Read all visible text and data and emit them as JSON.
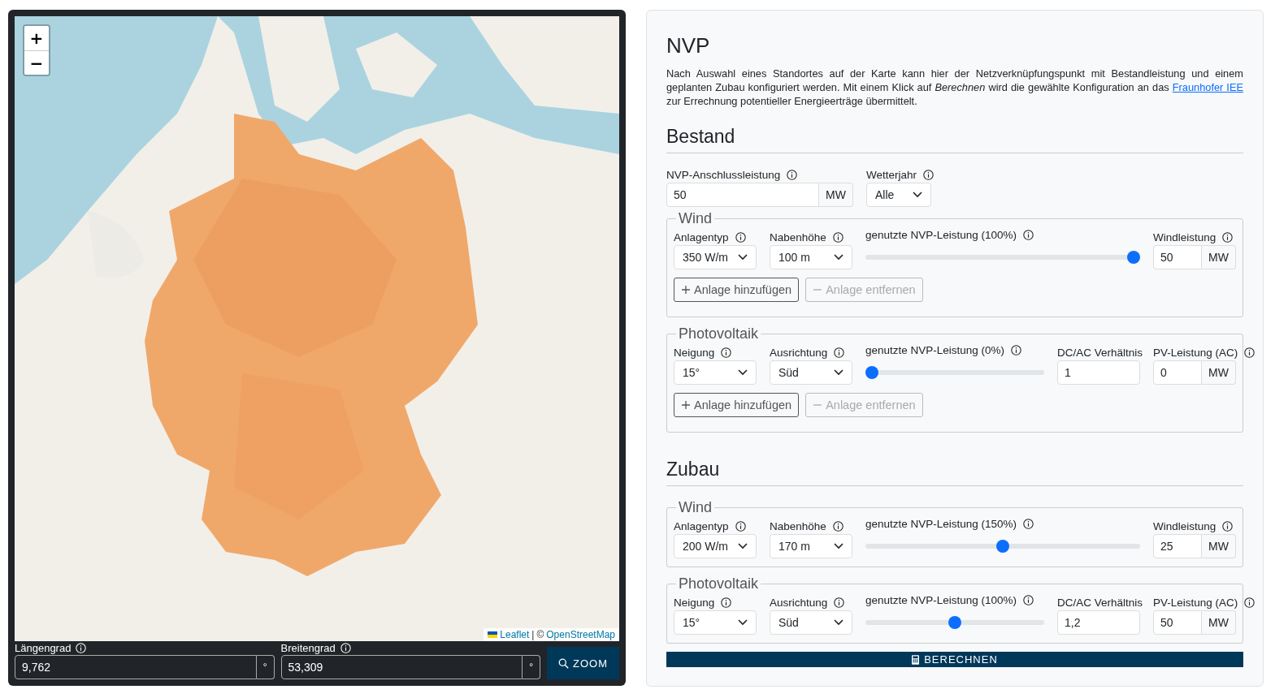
{
  "map": {
    "zoom_controls": [
      "+",
      "−"
    ],
    "attribution": {
      "links": [
        "Leaflet",
        "OpenStreetMap"
      ],
      "separator": "|",
      "copyright": "©"
    }
  },
  "coordinates": {
    "fields": [
      {
        "label": "Längengrad",
        "info": true,
        "value": "9,762",
        "unit": "°"
      },
      {
        "label": "Breitengrad",
        "info": true,
        "value": "53,309",
        "unit": "°"
      }
    ],
    "zoom_button": "ZOOM"
  },
  "panel": {
    "title": "NVP",
    "description": {
      "text": "Nach Auswahl eines Standortes auf der Karte kann hier der Netzverknüpfungspunkt mit Bestandleistung und einem geplanten Zubau konfiguriert werden. Mit einem Klick auf *Berechnen* wird die gewählte Konfiguration an das",
      "link": "Fraunhofer IEE",
      "text_after": "zur Errechnung potentieller Energieerträge übermittelt."
    },
    "sections": [
      {
        "title": "Bestand",
        "top_fields": [
          {
            "kind": "input-unit",
            "label": "NVP-Anschlussleistung",
            "info": true,
            "value": "50",
            "unit": "MW"
          },
          {
            "kind": "select",
            "label": "Wetterjahr",
            "info": true,
            "value": "Alle"
          }
        ],
        "groups": [
          {
            "title": "Wind",
            "fields": [
              {
                "kind": "select",
                "label": "Anlagentyp",
                "info": true,
                "value": "350 W/m"
              },
              {
                "kind": "select",
                "label": "Nabenhöhe",
                "info": true,
                "value": "100 m"
              },
              {
                "kind": "slider",
                "label": "genutzte NVP-Leistung (100%)",
                "info": true,
                "level": 1
              },
              {
                "kind": "input-unit",
                "label": "Windleistung",
                "info": true,
                "value": "50",
                "unit": "MW"
              }
            ],
            "buttons": [
              {
                "kind": "add",
                "label": "Anlage hinzufügen",
                "disabled": false
              },
              {
                "kind": "remove",
                "label": "Anlage entfernen",
                "disabled": true
              }
            ]
          },
          {
            "title": "Photovoltaik",
            "fields": [
              {
                "kind": "select",
                "label": "Neigung",
                "info": true,
                "value": "15°"
              },
              {
                "kind": "select",
                "label": "Ausrichtung",
                "info": true,
                "value": "Süd"
              },
              {
                "kind": "slider",
                "label": "genutzte NVP-Leistung (0%)",
                "info": true,
                "level": 0
              },
              {
                "kind": "input",
                "label": "DC/AC Verhältnis",
                "info": false,
                "value": "1"
              },
              {
                "kind": "input-unit",
                "label": "PV-Leistung (AC)",
                "info": true,
                "value": "0",
                "unit": "MW"
              }
            ],
            "buttons": [
              {
                "kind": "add",
                "label": "Anlage hinzufügen",
                "disabled": false
              },
              {
                "kind": "remove",
                "label": "Anlage entfernen",
                "disabled": true
              }
            ]
          }
        ]
      },
      {
        "title": "Zubau",
        "groups": [
          {
            "title": "Wind",
            "fields": [
              {
                "kind": "select",
                "label": "Anlagentyp",
                "info": true,
                "value": "200 W/m"
              },
              {
                "kind": "select",
                "label": "Nabenhöhe",
                "info": true,
                "value": "170 m"
              },
              {
                "kind": "slider",
                "label": "genutzte NVP-Leistung (150%)",
                "info": true,
                "level": 0.5
              },
              {
                "kind": "input-unit",
                "label": "Windleistung",
                "info": true,
                "value": "25",
                "unit": "MW"
              }
            ]
          },
          {
            "title": "Photovoltaik",
            "fields": [
              {
                "kind": "select",
                "label": "Neigung",
                "info": true,
                "value": "15°"
              },
              {
                "kind": "select",
                "label": "Ausrichtung",
                "info": true,
                "value": "Süd"
              },
              {
                "kind": "slider",
                "label": "genutzte NVP-Leistung (100%)",
                "info": true,
                "level": 0.5
              },
              {
                "kind": "input",
                "label": "DC/AC Verhältnis",
                "info": false,
                "value": "1,2"
              },
              {
                "kind": "input-unit",
                "label": "PV-Leistung (AC)",
                "info": true,
                "value": "50",
                "unit": "MW"
              }
            ]
          }
        ]
      }
    ],
    "submit": "BERECHNEN"
  }
}
